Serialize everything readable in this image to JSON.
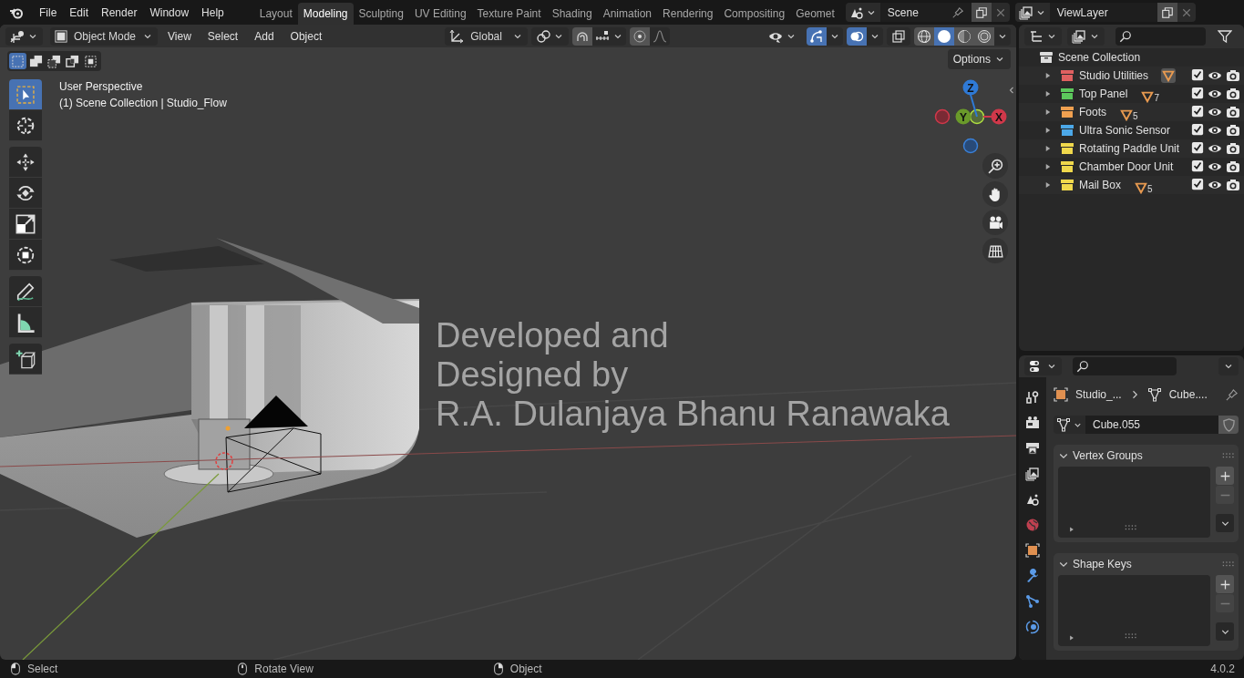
{
  "menu": [
    "File",
    "Edit",
    "Render",
    "Window",
    "Help"
  ],
  "workspaces": [
    {
      "label": "Layout",
      "selected": false
    },
    {
      "label": "Modeling",
      "selected": true
    },
    {
      "label": "Sculpting",
      "selected": false
    },
    {
      "label": "UV Editing",
      "selected": false
    },
    {
      "label": "Texture Paint",
      "selected": false
    },
    {
      "label": "Shading",
      "selected": false
    },
    {
      "label": "Animation",
      "selected": false
    },
    {
      "label": "Rendering",
      "selected": false
    },
    {
      "label": "Compositing",
      "selected": false
    },
    {
      "label": "Geomet",
      "selected": false
    }
  ],
  "scene": {
    "value": "Scene"
  },
  "view_layer": {
    "value": "ViewLayer"
  },
  "viewport_header": {
    "mode": "Object Mode",
    "menus": [
      "View",
      "Select",
      "Add",
      "Object"
    ],
    "orientation": "Global",
    "gizmos": {
      "on": true
    },
    "overlays": {
      "on": true
    },
    "shading": [
      {
        "kind": "wireframe",
        "selected": false
      },
      {
        "kind": "solid",
        "selected": true
      },
      {
        "kind": "material",
        "selected": false
      },
      {
        "kind": "rendered",
        "selected": false
      }
    ],
    "options": "Options"
  },
  "select_modes": [
    {
      "kind": "new",
      "selected": true
    },
    {
      "kind": "extend",
      "selected": false
    },
    {
      "kind": "subtract",
      "selected": false
    },
    {
      "kind": "invert",
      "selected": false
    },
    {
      "kind": "intersect",
      "selected": false
    }
  ],
  "tools": [
    {
      "kind": "select",
      "selected": true
    },
    {
      "kind": "cursor",
      "selected": false
    },
    {
      "kind": "move",
      "selected": false
    },
    {
      "kind": "rotate",
      "selected": false
    },
    {
      "kind": "scale",
      "selected": false
    },
    {
      "kind": "transform",
      "selected": false
    },
    {
      "kind": "annotate",
      "selected": false
    },
    {
      "kind": "measure",
      "selected": false
    },
    {
      "kind": "add_cube",
      "selected": false
    }
  ],
  "viewport_info": [
    "User Perspective",
    "(1) Scene Collection | Studio_Flow"
  ],
  "scene_text": [
    "Developed and",
    "Designed by",
    "R.A. Dulanjaya Bhanu Ranawaka"
  ],
  "gizmo_axes": [
    "Z",
    "Y",
    "X"
  ],
  "outliner": {
    "root": "Scene Collection",
    "collections": [
      {
        "name": "Studio Utilities",
        "color": "#e06060",
        "badge": {
          "highlighted": true
        },
        "checked": true,
        "visible": true
      },
      {
        "name": "Top Panel",
        "color": "#5cc85c",
        "badge": {
          "count": "7",
          "highlighted": false
        },
        "checked": true,
        "visible": true
      },
      {
        "name": "Foots",
        "color": "#f0a050",
        "badge": {
          "count": "5",
          "highlighted": false
        },
        "checked": true,
        "visible": true
      },
      {
        "name": "Ultra Sonic Sensor",
        "color": "#4ca8e8",
        "checked": true,
        "visible": true
      },
      {
        "name": "Rotating Paddle Unit",
        "color": "#f0d84c",
        "checked": true,
        "visible": true
      },
      {
        "name": "Chamber Door Unit",
        "color": "#f0d84c",
        "checked": true,
        "visible": true
      },
      {
        "name": "Mail Box",
        "color": "#f0d84c",
        "badge": {
          "count": "5",
          "highlighted": false
        },
        "checked": true,
        "visible": true
      }
    ]
  },
  "properties": {
    "tabs": [
      {
        "kind": "tool"
      },
      {
        "kind": "render"
      },
      {
        "kind": "output"
      },
      {
        "kind": "view_layer"
      },
      {
        "kind": "scene"
      },
      {
        "kind": "world"
      },
      {
        "kind": "object"
      },
      {
        "kind": "modifiers"
      },
      {
        "kind": "particles"
      },
      {
        "kind": "physics"
      }
    ],
    "breadcrumb": [
      "Studio_...",
      "Cube...."
    ],
    "datablock": "Cube.055",
    "panels": [
      {
        "title": "Vertex Groups",
        "expanded": true
      },
      {
        "title": "Shape Keys",
        "expanded": true
      }
    ]
  },
  "status_bar": {
    "hints": [
      "Select",
      "Rotate View",
      "Object"
    ],
    "version": "4.0.2"
  }
}
